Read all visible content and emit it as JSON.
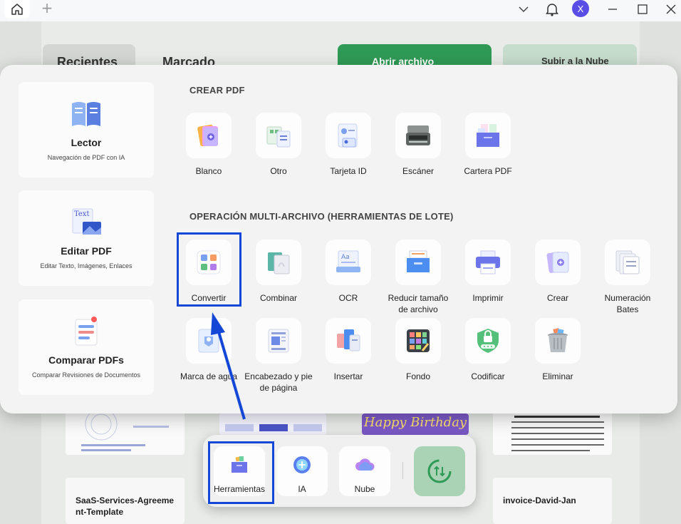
{
  "titlebar": {
    "avatar_letter": "X"
  },
  "background": {
    "tab_recent": "Recientes",
    "tab_marked": "Marcado",
    "open_file": "Abrir archivo",
    "upload_cloud": "Subir a la Nube",
    "file_left": "SaaS-Services-Agreement-Template",
    "file_right": "invoice-David-Jan",
    "thumb_birthday": "Happy Birthday"
  },
  "sidebar": {
    "items": [
      {
        "title": "Lector",
        "desc": "Navegación de PDF con IA"
      },
      {
        "title": "Editar PDF",
        "desc": "Editar Texto, Imágenes, Enlaces"
      },
      {
        "title": "Comparar PDFs",
        "desc": "Comparar Revisiones de Documentos"
      }
    ]
  },
  "create_pdf": {
    "title": "CREAR PDF",
    "tools": [
      {
        "label": "Blanco",
        "icon": "blank-pdf-icon"
      },
      {
        "label": "Otro",
        "icon": "other-file-icon"
      },
      {
        "label": "Tarjeta ID",
        "icon": "id-card-icon"
      },
      {
        "label": "Escáner",
        "icon": "scanner-icon"
      },
      {
        "label": "Cartera PDF",
        "icon": "pdf-portfolio-icon"
      }
    ]
  },
  "batch": {
    "title": "OPERACIÓN MULTI-ARCHIVO (HERRAMIENTAS DE LOTE)",
    "tools": [
      {
        "label": "Convertir",
        "icon": "convert-icon"
      },
      {
        "label": "Combinar",
        "icon": "combine-icon"
      },
      {
        "label": "OCR",
        "icon": "ocr-icon"
      },
      {
        "label": "Reducir tamaño de archivo",
        "icon": "compress-icon"
      },
      {
        "label": "Imprimir",
        "icon": "printer-icon"
      },
      {
        "label": "Crear",
        "icon": "create-icon"
      },
      {
        "label": "Numeración Bates",
        "icon": "bates-icon"
      },
      {
        "label": "Marca de agua",
        "icon": "watermark-icon"
      },
      {
        "label": "Encabezado y pie de página",
        "icon": "header-footer-icon"
      },
      {
        "label": "Insertar",
        "icon": "insert-icon"
      },
      {
        "label": "Fondo",
        "icon": "background-icon"
      },
      {
        "label": "Codificar",
        "icon": "encrypt-icon"
      },
      {
        "label": "Eliminar",
        "icon": "trash-icon"
      }
    ]
  },
  "dock": {
    "tools": "Herramientas",
    "ai": "IA",
    "cloud": "Nube"
  },
  "colors": {
    "highlight": "#1447d6",
    "accent_green": "#2f9a55"
  }
}
